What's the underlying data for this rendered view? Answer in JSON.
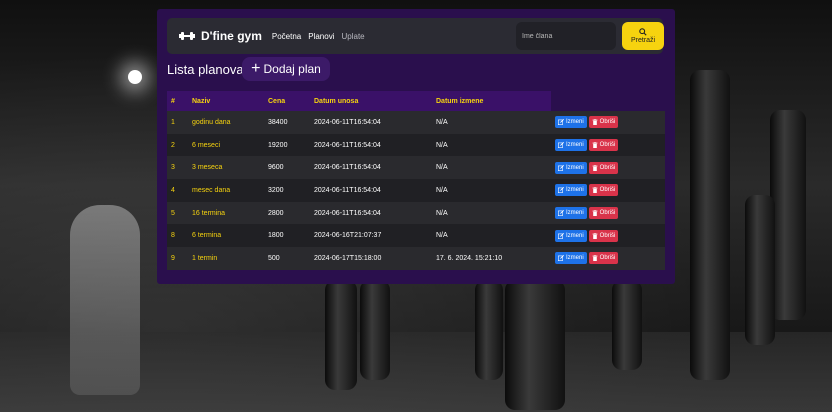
{
  "brand": {
    "name": "D'fine gym",
    "icon": "dumbbell-icon"
  },
  "nav": {
    "items": [
      "Početna",
      "Planovi",
      "Uplate"
    ],
    "active": "Planovi"
  },
  "search": {
    "placeholder": "Ime člana",
    "button_label": "Pretraži",
    "icon": "search-icon"
  },
  "page": {
    "title": "Lista planova",
    "add_button": "Dodaj plan"
  },
  "table": {
    "columns": [
      "#",
      "Naziv",
      "Cena",
      "Datum unosa",
      "Datum izmene"
    ],
    "rows": [
      {
        "id": "1",
        "naziv": "godinu dana",
        "cena": "38400",
        "datum_unosa": "2024-06-11T16:54:04",
        "datum_izmene": "N/A"
      },
      {
        "id": "2",
        "naziv": "6 meseci",
        "cena": "19200",
        "datum_unosa": "2024-06-11T16:54:04",
        "datum_izmene": "N/A"
      },
      {
        "id": "3",
        "naziv": "3 meseca",
        "cena": "9600",
        "datum_unosa": "2024-06-11T16:54:04",
        "datum_izmene": "N/A"
      },
      {
        "id": "4",
        "naziv": "mesec dana",
        "cena": "3200",
        "datum_unosa": "2024-06-11T16:54:04",
        "datum_izmene": "N/A"
      },
      {
        "id": "5",
        "naziv": "16 termina",
        "cena": "2800",
        "datum_unosa": "2024-06-11T16:54:04",
        "datum_izmene": "N/A"
      },
      {
        "id": "8",
        "naziv": "6 termina",
        "cena": "1800",
        "datum_unosa": "2024-06-16T21:07:37",
        "datum_izmene": "N/A"
      },
      {
        "id": "9",
        "naziv": "1 termin",
        "cena": "500",
        "datum_unosa": "2024-06-17T15:18:00",
        "datum_izmene": "17. 6. 2024. 15:21:10"
      }
    ],
    "edit_label": "Izmeni",
    "delete_label": "Obriši"
  },
  "colors": {
    "accent": "#f6d30f",
    "panel": "#2a0f4d",
    "edit": "#1e72e8",
    "delete": "#d9334a"
  }
}
